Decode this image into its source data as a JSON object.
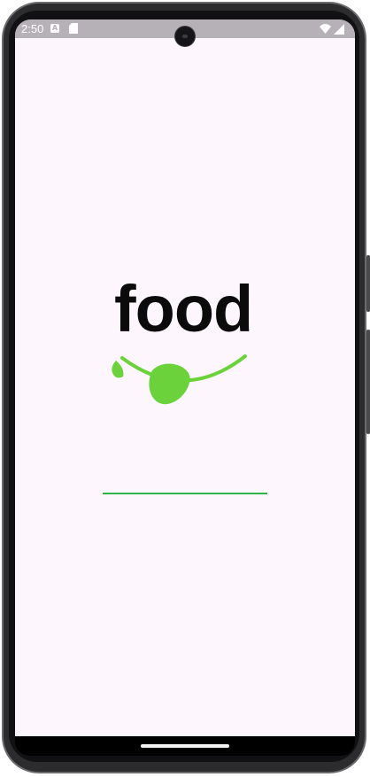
{
  "status_bar": {
    "time": "2:50",
    "notification_icon": "a-badge-icon",
    "storage_icon": "sd-card-icon",
    "wifi_icon": "wifi-icon",
    "signal_icon": "cell-signal-icon"
  },
  "splash": {
    "logo_text": "food",
    "logo_color": "#0b0b0b",
    "accent_color": "#6cd23c",
    "progress_color": "#2fb344",
    "progress_fraction": 1.0
  },
  "colors": {
    "screen_background": "#fdf7fd",
    "status_bar_background": "#b6b1b6"
  }
}
